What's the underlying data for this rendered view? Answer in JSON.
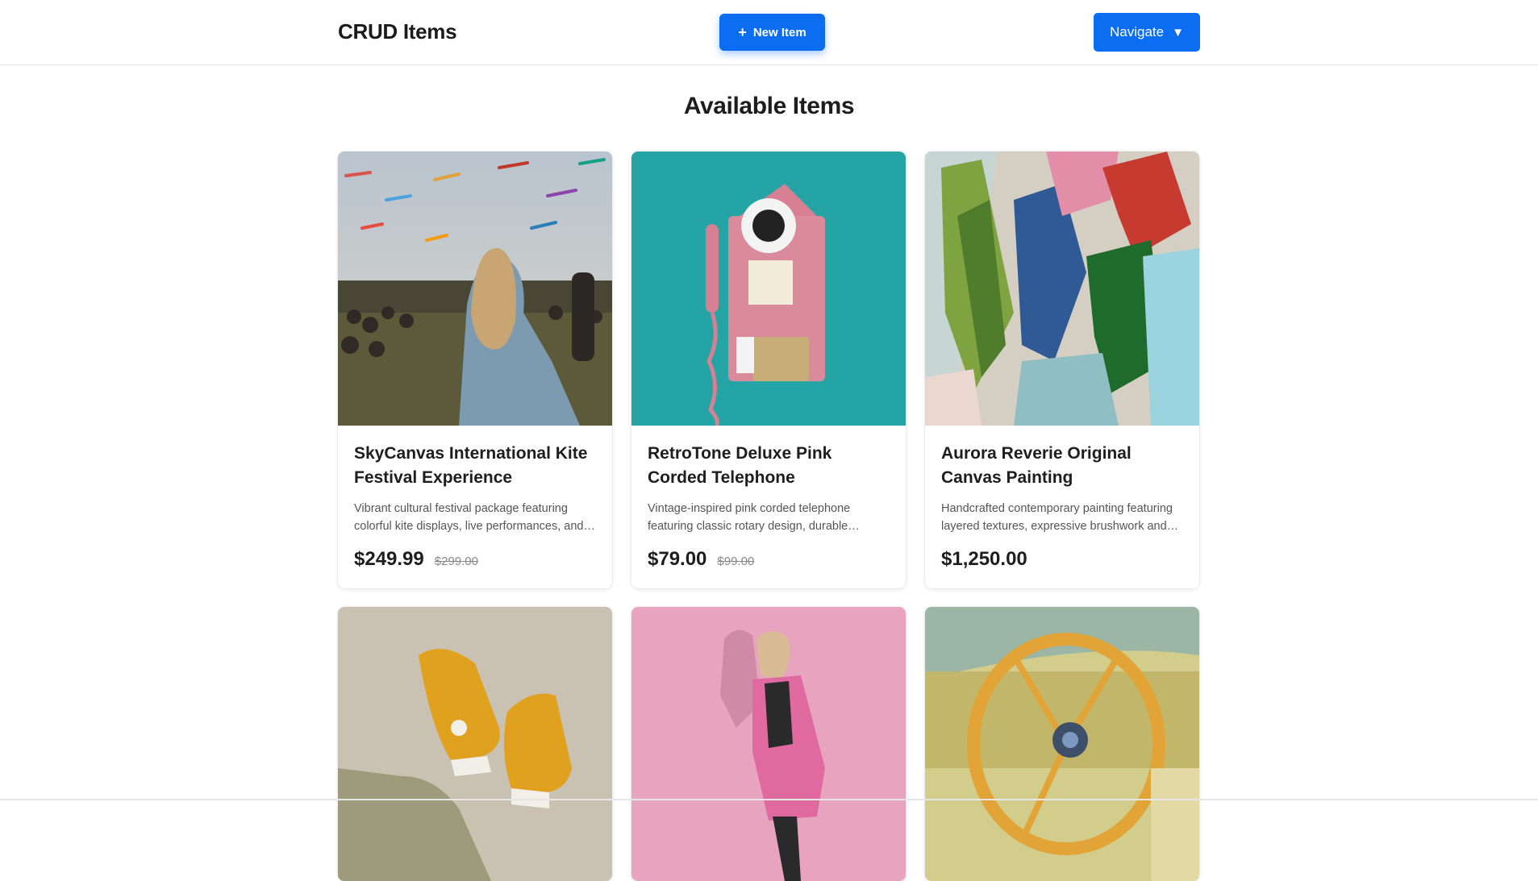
{
  "header": {
    "brand": "CRUD Items",
    "new_item_label": "New Item",
    "new_item_icon": "+",
    "navigate_label": "Navigate",
    "navigate_icon": "▼"
  },
  "main": {
    "title": "Available Items",
    "items": [
      {
        "title": "SkyCanvas International Kite Festival Experience",
        "description": "Vibrant cultural festival package featuring colorful kite displays, live performances, and local cuisine tastings.",
        "price": "$249.99",
        "old_price": "$299.00",
        "image": "kite-festival-photo"
      },
      {
        "title": "RetroTone Deluxe Pink Corded Telephone",
        "description": "Vintage-inspired pink corded telephone featuring classic rotary design, durable construction and coin slot styling.",
        "price": "$79.00",
        "old_price": "$99.00",
        "image": "pink-telephone-photo"
      },
      {
        "title": "Aurora Reverie Original Canvas Painting",
        "description": "Handcrafted contemporary painting featuring layered textures, expressive brushwork and bold colors.",
        "price": "$1,250.00",
        "old_price": "",
        "image": "abstract-painting-photo"
      },
      {
        "title": "",
        "description": "",
        "price": "",
        "old_price": "",
        "image": "yellow-sneakers-photo"
      },
      {
        "title": "",
        "description": "",
        "price": "",
        "old_price": "",
        "image": "pink-coat-photo"
      },
      {
        "title": "",
        "description": "",
        "price": "",
        "old_price": "",
        "image": "steering-wheel-photo"
      }
    ]
  },
  "colors": {
    "accent": "#0a6df2",
    "text": "#1e1e1e",
    "muted": "#555555"
  }
}
